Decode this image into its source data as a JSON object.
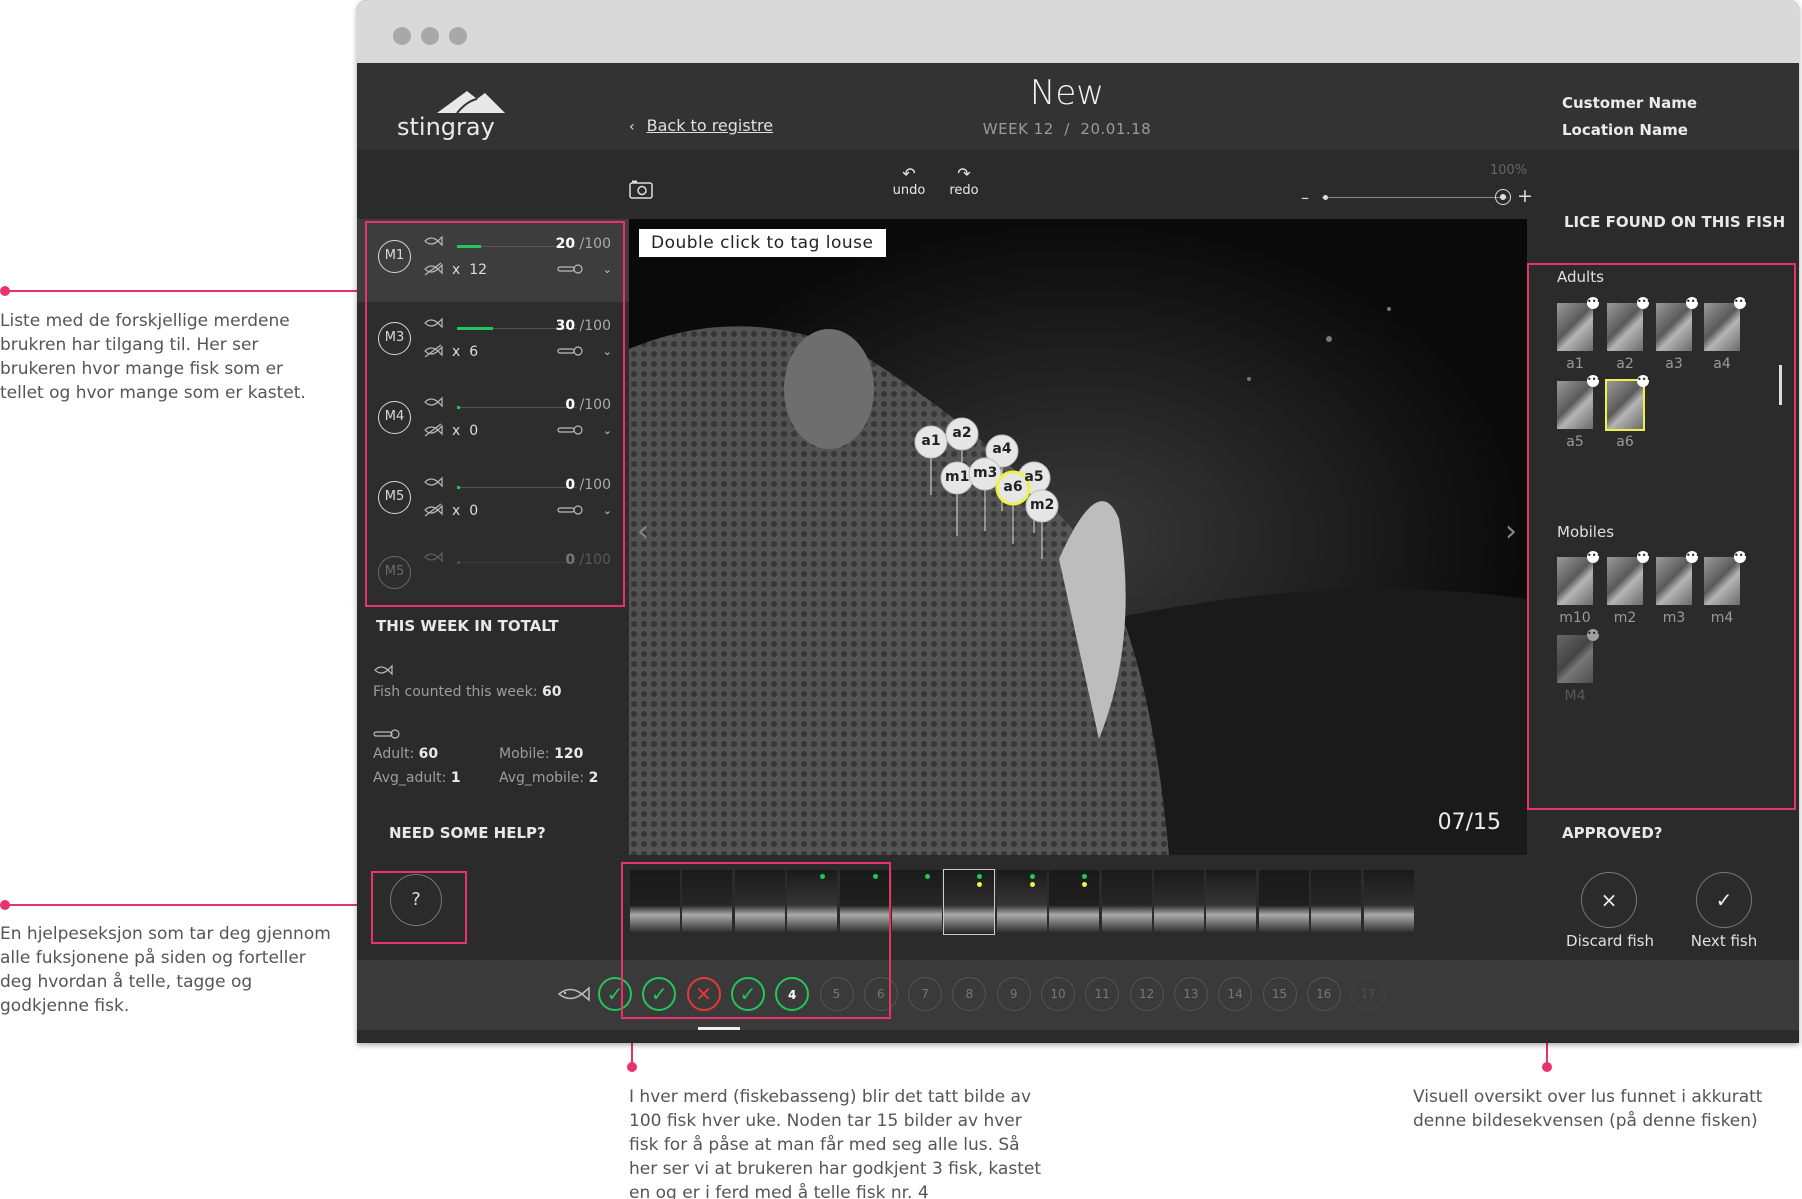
{
  "annotations": {
    "pens": "Liste med de forskjellige merdene brukren har tilgang til. Her ser brukeren hvor mange fisk som er tellet og hvor mange som er kastet.",
    "help": "En hjelpeseksjon som tar deg gjennom alle fuksjonene på siden og forteller deg hvordan å telle, tagge og godkjenne fisk.",
    "progress": "I hver merd (fiskebasseng) blir det tatt bilde av 100 fisk hver uke. Noden tar 15 bilder av hver fisk for å påse at man får med seg alle lus. Så her ser vi at brukeren har godkjent 3 fisk, kastet en og er i ferd med å telle fisk nr. 4",
    "lice": "Visuell oversikt over lus funnet i akkuratt denne bildesekvensen (på denne fisken)"
  },
  "header": {
    "logo": "stingray",
    "back_label": "Back to registre",
    "title": "New",
    "week": "WEEK 12",
    "separator": "/",
    "date": "20.01.18",
    "customer": "Customer Name",
    "location": "Location Name"
  },
  "toolbar": {
    "undo": "undo",
    "redo": "redo",
    "zoom": "100%",
    "zoom_minus": "–",
    "zoom_plus": "+"
  },
  "pens": [
    {
      "id": "M1",
      "counted": "20",
      "total": "/100",
      "discarded": "12",
      "fill_ratio": 0.2
    },
    {
      "id": "M3",
      "counted": "30",
      "total": "/100",
      "discarded": "6",
      "fill_ratio": 0.3
    },
    {
      "id": "M4",
      "counted": "0",
      "total": "/100",
      "discarded": "0",
      "fill_ratio": 0.0
    },
    {
      "id": "M5",
      "counted": "0",
      "total": "/100",
      "discarded": "0",
      "fill_ratio": 0.0
    },
    {
      "id": "M5",
      "counted": "0",
      "total": "/100",
      "discarded": "",
      "fill_ratio": 0.0
    }
  ],
  "pen_x_prefix": "x",
  "week": {
    "title": "THIS WEEK IN TOTALT",
    "fish_label": "Fish counted this week:",
    "fish_value": "60",
    "adult_label": "Adult:",
    "adult_value": "60",
    "mobile_label": "Mobile:",
    "mobile_value": "120",
    "avg_adult_label": "Avg_adult:",
    "avg_adult_value": "1",
    "avg_mobile_label": "Avg_mobile:",
    "avg_mobile_value": "2"
  },
  "help": {
    "title": "NEED SOME HELP?",
    "button": "?"
  },
  "viewer": {
    "hint": "Double click to tag louse",
    "counter": "07/15",
    "prev": "‹",
    "next": "›",
    "pins": [
      "a1",
      "a2",
      "a4",
      "m1",
      "m3",
      "a6",
      "a5",
      "m2"
    ]
  },
  "lice": {
    "title": "LICE FOUND ON THIS FISH",
    "adults_label": "Adults",
    "adults": [
      "a1",
      "a2",
      "a3",
      "a4",
      "a5",
      "a6"
    ],
    "mobiles_label": "Mobiles",
    "mobiles": [
      "m10",
      "m2",
      "m3",
      "m4",
      "M4"
    ]
  },
  "approve": {
    "title": "APPROVED?",
    "discard_label": "Discard fish",
    "discard_icon": "×",
    "next_label": "Next fish",
    "next_icon": "✓"
  },
  "progress": {
    "steps": [
      {
        "label": "✓",
        "state": "ok"
      },
      {
        "label": "✓",
        "state": "ok"
      },
      {
        "label": "✕",
        "state": "bad"
      },
      {
        "label": "✓",
        "state": "ok"
      },
      {
        "label": "4",
        "state": "current"
      },
      {
        "label": "5",
        "state": "todo"
      },
      {
        "label": "6",
        "state": "todo"
      },
      {
        "label": "7",
        "state": "todo"
      },
      {
        "label": "8",
        "state": "todo"
      },
      {
        "label": "9",
        "state": "todo"
      },
      {
        "label": "10",
        "state": "todo"
      },
      {
        "label": "11",
        "state": "todo"
      },
      {
        "label": "12",
        "state": "todo"
      },
      {
        "label": "13",
        "state": "todo"
      },
      {
        "label": "14",
        "state": "todo"
      },
      {
        "label": "15",
        "state": "todo"
      },
      {
        "label": "16",
        "state": "todo"
      },
      {
        "label": "17",
        "state": "todo"
      }
    ]
  },
  "colors": {
    "accent": "#e8336a",
    "ok": "#22c65a",
    "bad": "#e53935",
    "highlight": "#f0f04a"
  }
}
